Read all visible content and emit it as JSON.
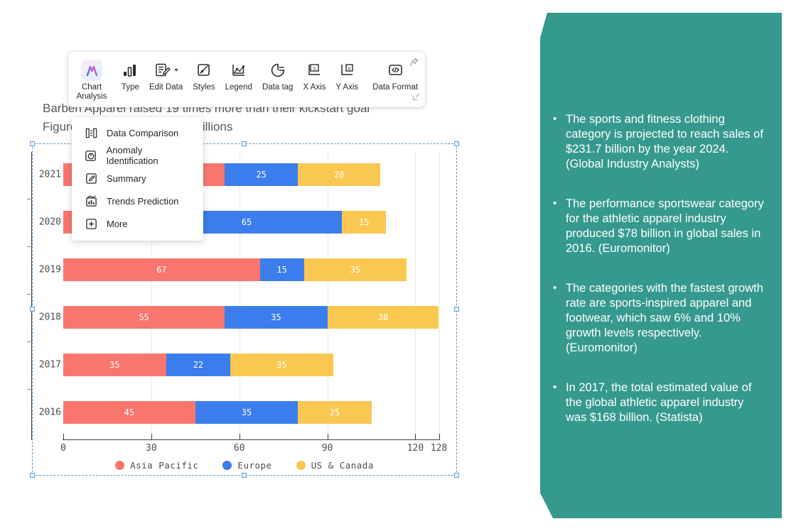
{
  "slide": {
    "headline": "Barben Apparel raised 19 times more than their kickstart goal",
    "subhead": "Figure 1: Sales Numbers in Millions"
  },
  "toolbar": {
    "items": [
      {
        "label": "Chart Analysis",
        "icon": "chart-analysis-icon",
        "has_caret": false
      },
      {
        "label": "Type",
        "icon": "bar-chart-icon",
        "has_caret": false
      },
      {
        "label": "Edit Data",
        "icon": "edit-data-icon",
        "has_caret": true
      },
      {
        "label": "Styles",
        "icon": "styles-icon",
        "has_caret": false
      },
      {
        "label": "Legend",
        "icon": "legend-icon",
        "has_caret": false
      },
      {
        "label": "Data tag",
        "icon": "data-tag-icon",
        "has_caret": false
      },
      {
        "label": "X Axis",
        "icon": "x-axis-icon",
        "has_caret": false
      },
      {
        "label": "Y Axis",
        "icon": "y-axis-icon",
        "has_caret": false
      },
      {
        "label": "Data Format",
        "icon": "data-format-icon",
        "has_caret": false
      }
    ],
    "pin_icon": "pin-icon",
    "resize_icon": "resize-handle-icon"
  },
  "dropdown": {
    "items": [
      {
        "label": "Data Comparison",
        "icon": "data-comparison-icon"
      },
      {
        "label": "Anomaly Identification",
        "icon": "anomaly-identification-icon"
      },
      {
        "label": "Summary",
        "icon": "summary-icon"
      },
      {
        "label": "Trends Prediction",
        "icon": "trends-prediction-icon"
      },
      {
        "label": "More",
        "icon": "more-plus-icon"
      }
    ]
  },
  "panel": {
    "background_color": "#35998e",
    "bullets": [
      "The sports and fitness clothing category is projected to reach sales of $231.7 billion by the year 2024. (Global Industry Analysts)",
      "The performance sportswear category for the athletic apparel industry produced $78 billion in global sales in 2016. (Euromonitor)",
      "The categories with the fastest growth rate are sports-inspired apparel and footwear, which saw 6% and 10% growth levels respectively. (Euromonitor)",
      "In 2017, the total estimated value of the global athletic apparel industry was $168 billion. (Statista)"
    ]
  },
  "chart_data": {
    "type": "bar",
    "orientation": "horizontal",
    "stacked": true,
    "title": "Figure 1: Sales Numbers in Millions",
    "xlabel": "",
    "ylabel": "",
    "categories": [
      "2021",
      "2020",
      "2019",
      "2018",
      "2017",
      "2016"
    ],
    "series": [
      {
        "name": "Asia Pacific",
        "color": "#f8766d",
        "values": [
          55,
          30,
          67,
          55,
          35,
          45
        ]
      },
      {
        "name": "Europe",
        "color": "#3b7ded",
        "values": [
          25,
          65,
          15,
          35,
          22,
          35
        ]
      },
      {
        "name": "US & Canada",
        "color": "#fac751",
        "values": [
          28,
          15,
          35,
          38,
          35,
          25
        ]
      }
    ],
    "xlim": [
      0,
      128
    ],
    "xticks": [
      0,
      30,
      60,
      90,
      120,
      128
    ],
    "xticklabels": [
      "0",
      "30",
      "60",
      "90",
      "120",
      "128"
    ],
    "grid": true,
    "legend_position": "bottom"
  }
}
